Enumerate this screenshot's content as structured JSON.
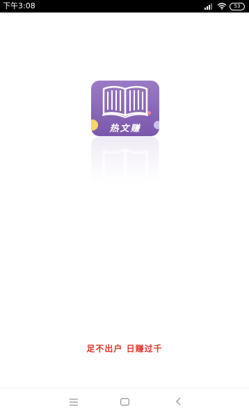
{
  "status_bar": {
    "time": "下午3:08",
    "battery": "53",
    "icons": [
      "signal-icon",
      "wifi-icon",
      "battery-icon"
    ]
  },
  "app": {
    "name": "热文赚",
    "icon": "open-book-icon",
    "colors": {
      "icon_top": "#9a7bc4",
      "icon_bottom": "#7b57ab",
      "accent_yellow": "#f5d867",
      "accent_blue": "#c6c2ef"
    }
  },
  "slogan": {
    "text": "足不出户 日赚过千",
    "color": "#e2342a"
  },
  "nav_bar": {
    "buttons": [
      "menu-icon",
      "home-icon",
      "back-icon"
    ]
  }
}
